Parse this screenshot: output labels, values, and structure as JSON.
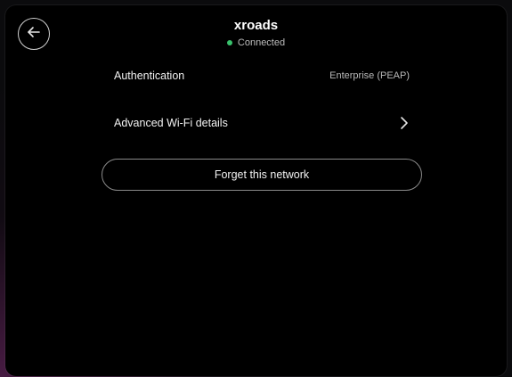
{
  "header": {
    "network_name": "xroads",
    "status_text": "Connected",
    "status_color": "#39c16c"
  },
  "back_button": {
    "icon": "arrow-left-icon"
  },
  "details": {
    "authentication_label": "Authentication",
    "authentication_value": "Enterprise (PEAP)",
    "advanced_label": "Advanced Wi-Fi details",
    "advanced_icon": "chevron-right-icon"
  },
  "actions": {
    "forget_label": "Forget this network"
  }
}
